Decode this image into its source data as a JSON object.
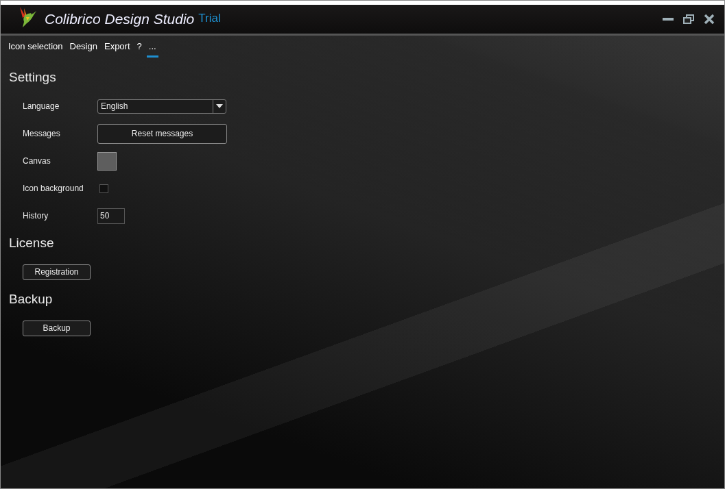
{
  "window": {
    "title": "Colibrico Design Studio",
    "edition": "Trial"
  },
  "menu": [
    {
      "label": "Icon selection",
      "selected": false
    },
    {
      "label": "Design",
      "selected": false
    },
    {
      "label": "Export",
      "selected": false
    },
    {
      "label": "?",
      "selected": false
    },
    {
      "label": "...",
      "selected": true
    }
  ],
  "sections": [
    {
      "title": "Settings",
      "rows": [
        {
          "kind": "dropdown",
          "label": "Language",
          "value": "English"
        },
        {
          "kind": "button",
          "label": "Messages",
          "value": "Reset messages"
        },
        {
          "kind": "color",
          "label": "Canvas",
          "color": "#5e5e5e"
        },
        {
          "kind": "checkbox",
          "label": "Icon background",
          "checked": false
        },
        {
          "kind": "number",
          "label": "History",
          "value": "50"
        }
      ]
    },
    {
      "title": "License",
      "rows": [
        {
          "kind": "wide-button",
          "value": "Registration"
        }
      ]
    },
    {
      "title": "Backup",
      "rows": [
        {
          "kind": "wide-button",
          "value": "Backup"
        }
      ]
    }
  ]
}
